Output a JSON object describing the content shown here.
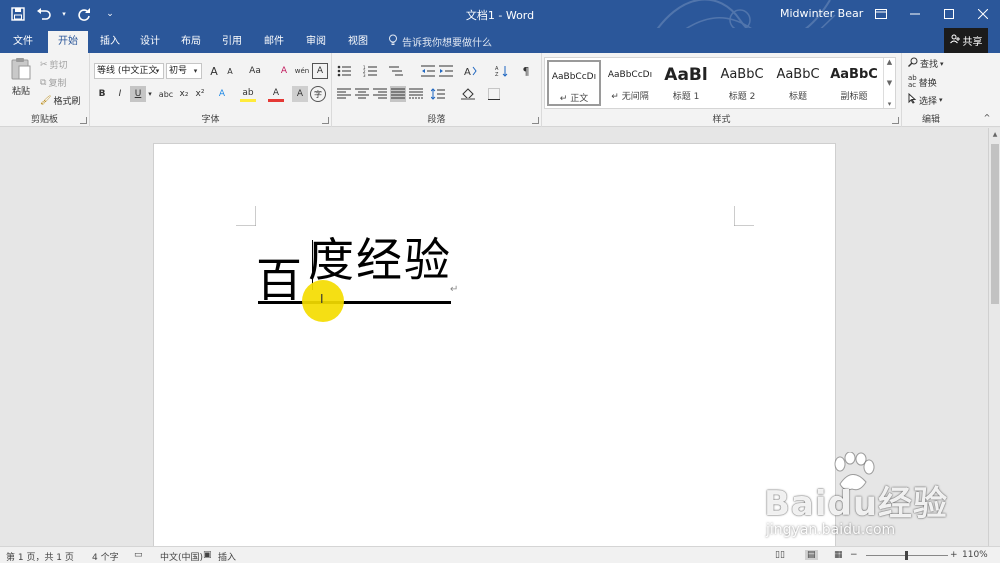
{
  "titlebar": {
    "title": "文档1 - Word",
    "user": "Midwinter Bear",
    "accent": "#2b579a"
  },
  "tabs": [
    "文件",
    "开始",
    "插入",
    "设计",
    "布局",
    "引用",
    "邮件",
    "审阅",
    "视图"
  ],
  "active_tab": "开始",
  "tell_me": "告诉我你想要做什么",
  "share": "共享",
  "ribbon": {
    "clipboard": {
      "label": "剪贴板",
      "paste": "粘贴",
      "cut": "剪切",
      "copy": "复制",
      "format_painter": "格式刷"
    },
    "font": {
      "label": "字体",
      "font_name": "等线 (中文正文",
      "font_size": "初号",
      "grow": "A",
      "shrink": "A",
      "change_case": "Aa",
      "clear_format": "A",
      "phonetic": "wén",
      "border_char": "A",
      "bold": "B",
      "italic": "I",
      "underline": "U",
      "strikethrough": "abc",
      "subscript": "x₂",
      "superscript": "x²",
      "text_effects": "A",
      "highlight": "ab",
      "font_color": "A",
      "char_shading": "A",
      "enclose": "字"
    },
    "paragraph": {
      "label": "段落"
    },
    "styles": {
      "label": "样式",
      "items": [
        {
          "sample": "AaBbCcDı",
          "name": "↵ 正文"
        },
        {
          "sample": "AaBbCcDı",
          "name": "↵ 无间隔"
        },
        {
          "sample": "AaBl",
          "name": "标题 1"
        },
        {
          "sample": "AaBbC",
          "name": "标题 2"
        },
        {
          "sample": "AaBbC",
          "name": "标题"
        },
        {
          "sample": "AaBbC",
          "name": "副标题"
        }
      ]
    },
    "editing": {
      "label": "编辑",
      "find": "查找",
      "replace": "替换",
      "select": "选择"
    }
  },
  "document": {
    "chars": [
      "百",
      "度",
      "经",
      "验"
    ],
    "paragraph_mark": "↵"
  },
  "watermark": {
    "brand": "Baidu经验",
    "url": "jingyan.baidu.com"
  },
  "statusbar": {
    "page": "第 1 页，共 1 页",
    "words": "4 个字",
    "language": "中文(中国)",
    "mode": "插入",
    "zoom": "110%"
  }
}
